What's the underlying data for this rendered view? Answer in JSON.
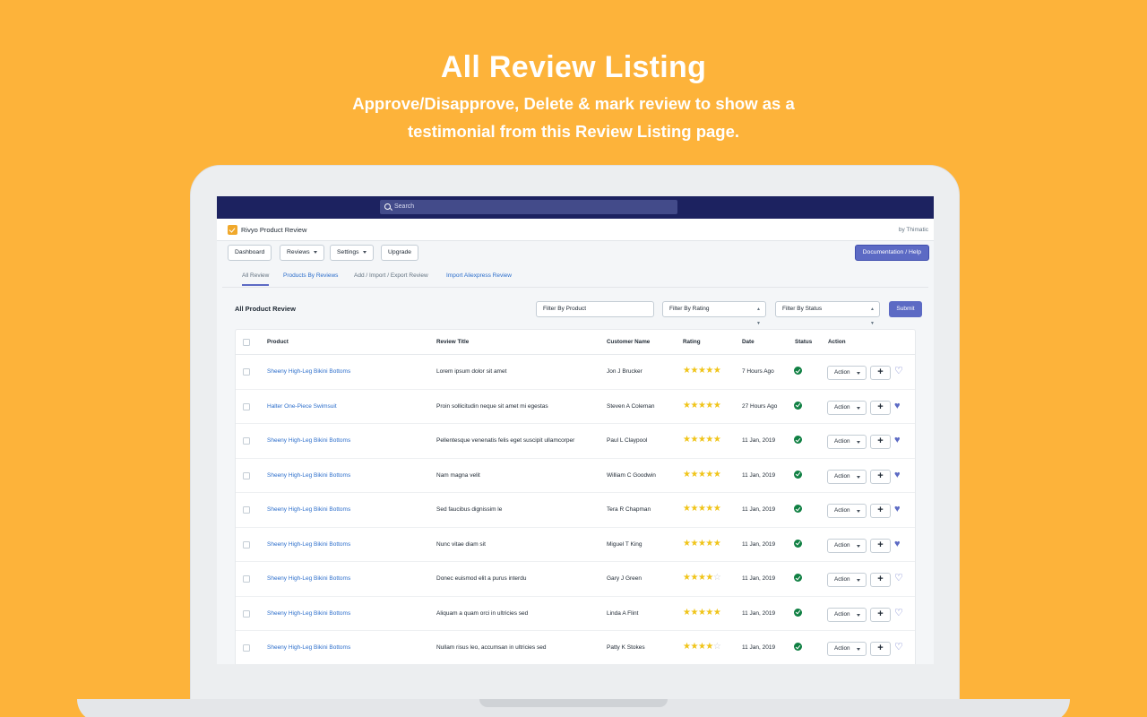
{
  "hero": {
    "title": "All Review Listing",
    "subtitle_line1": "Approve/Disapprove, Delete & mark review to show as a",
    "subtitle_line2": "testimonial from this Review Listing page."
  },
  "topbar": {
    "search_placeholder": "Search"
  },
  "app": {
    "name": "Rivyo Product Review",
    "by": "by Thimatic"
  },
  "nav": {
    "dashboard": "Dashboard",
    "reviews": "Reviews",
    "settings": "Settings",
    "upgrade": "Upgrade",
    "documentation": "Documentation / Help"
  },
  "tabs": [
    {
      "label": "All Review",
      "active": true
    },
    {
      "label": "Products By Reviews",
      "active": false
    },
    {
      "label": "Add / Import / Export Review",
      "active": false
    },
    {
      "label": "Import Aliexpress Review",
      "active": false
    }
  ],
  "filters": {
    "title": "All Product Review",
    "by_product": "Filter By Product",
    "by_rating": "Filter By Rating",
    "by_status": "Filter By Status",
    "submit": "Submit"
  },
  "table": {
    "columns": [
      "Product",
      "Review Title",
      "Customer Name",
      "Rating",
      "Date",
      "Status",
      "Action"
    ],
    "action_label": "Action",
    "rows": [
      {
        "product": "Sheeny High-Leg Bikini Bottoms",
        "title": "Lorem ipsum dolor sit amet",
        "customer": "Jon J Brucker",
        "rating": 5,
        "date": "7 Hours Ago",
        "favorite": false
      },
      {
        "product": "Halter One-Piece Swimsuit",
        "title": "Proin sollicitudin neque sit amet mi egestas",
        "customer": "Steven A Coleman",
        "rating": 5,
        "date": "27 Hours Ago",
        "favorite": true
      },
      {
        "product": "Sheeny High-Leg Bikini Bottoms",
        "title": "Pellentesque venenatis felis eget suscipit ullamcorper",
        "customer": "Paul L Claypool",
        "rating": 5,
        "date": "11 Jan, 2019",
        "favorite": true
      },
      {
        "product": "Sheeny High-Leg Bikini Bottoms",
        "title": "Nam magna velit",
        "customer": "William C Goodwin",
        "rating": 5,
        "date": "11 Jan, 2019",
        "favorite": true
      },
      {
        "product": "Sheeny High-Leg Bikini Bottoms",
        "title": "Sed faucibus dignissim le",
        "customer": "Tera R Chapman",
        "rating": 5,
        "date": "11 Jan, 2019",
        "favorite": true
      },
      {
        "product": "Sheeny High-Leg Bikini Bottoms",
        "title": "Nunc vitae diam sit",
        "customer": "Miguel T King",
        "rating": 5,
        "date": "11 Jan, 2019",
        "favorite": true
      },
      {
        "product": "Sheeny High-Leg Bikini Bottoms",
        "title": "Donec euismod elit a purus interdu",
        "customer": "Gary J Green",
        "rating": 4,
        "date": "11 Jan, 2019",
        "favorite": false
      },
      {
        "product": "Sheeny High-Leg Bikini Bottoms",
        "title": "Aliquam a quam orci in ultricies sed",
        "customer": "Linda A Flint",
        "rating": 5,
        "date": "11 Jan, 2019",
        "favorite": false
      },
      {
        "product": "Sheeny High-Leg Bikini Bottoms",
        "title": "Nullam risus leo, accumsan in ultricies sed",
        "customer": "Patty K Stokes",
        "rating": 4,
        "date": "11 Jan, 2019",
        "favorite": false
      }
    ]
  },
  "colors": {
    "background": "#FDB33A",
    "topbar": "#1C2260",
    "accent": "#5C6AC4",
    "link": "#2C6ECB",
    "star": "#F0C419",
    "status_ok": "#108043"
  },
  "icons": [
    "search-icon",
    "app-logo-icon",
    "chevron-down-icon",
    "star-icon",
    "check-circle-icon",
    "plus-icon",
    "heart-icon"
  ]
}
